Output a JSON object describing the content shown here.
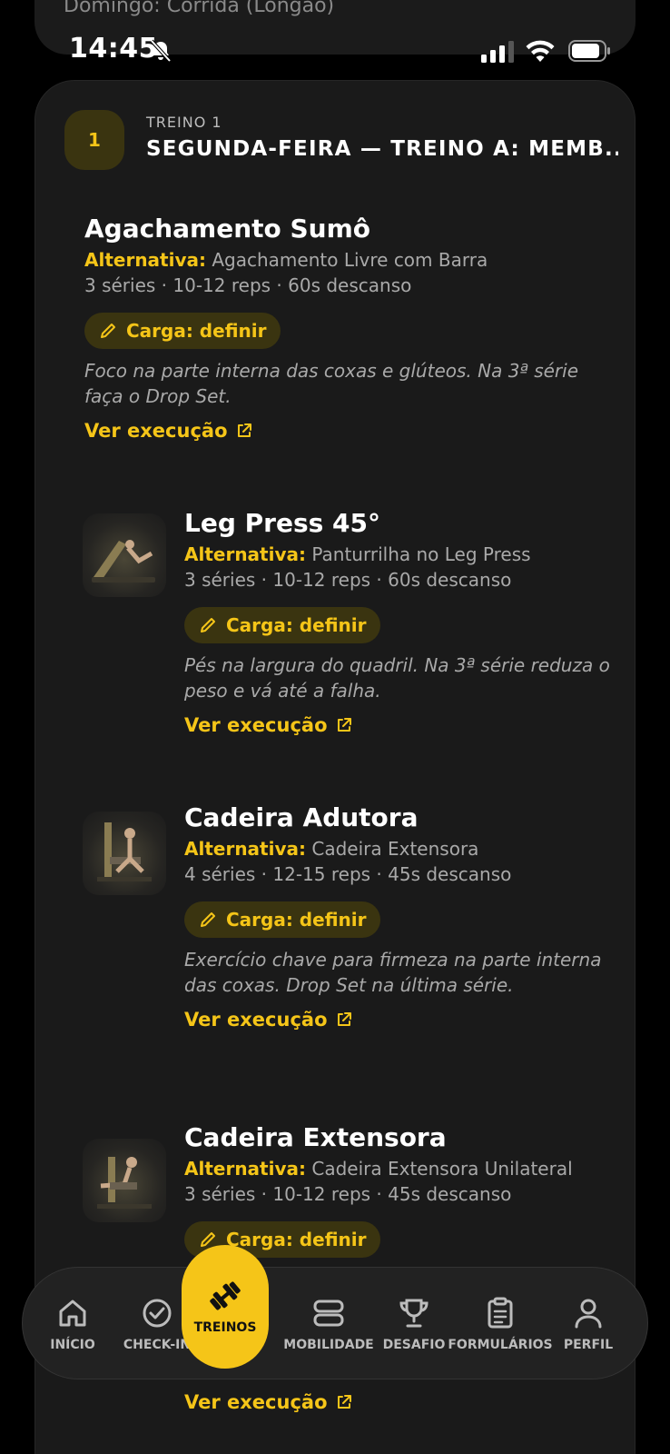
{
  "prev_card": {
    "text": "Domingo: Corrida (Longão)"
  },
  "status": {
    "time": "14:45"
  },
  "workout": {
    "number": "1",
    "subtitle": "TREINO 1",
    "title": "SEGUNDA-FEIRA — TREINO A: MEMB..."
  },
  "exercises": [
    {
      "name": "Agachamento Sumô",
      "alt_label": "Alternativa:",
      "alt_value": "Agachamento Livre com Barra",
      "meta": "3 séries · 10-12 reps · 60s descanso",
      "load": "Carga: definir",
      "note": "Foco na parte interna das coxas e glúteos. Na 3ª série faça o Drop Set.",
      "exec": "Ver execução"
    },
    {
      "name": "Leg Press 45°",
      "alt_label": "Alternativa:",
      "alt_value": "Panturrilha no Leg Press",
      "meta": "3 séries · 10-12 reps · 60s descanso",
      "load": "Carga: definir",
      "note": "Pés na largura do quadril. Na 3ª série reduza o peso e vá até a falha.",
      "exec": "Ver execução"
    },
    {
      "name": "Cadeira Adutora",
      "alt_label": "Alternativa:",
      "alt_value": "Cadeira Extensora",
      "meta": "4 séries · 12-15 reps · 45s descanso",
      "load": "Carga: definir",
      "note": "Exercício chave para firmeza na parte interna das coxas. Drop Set na última série.",
      "exec": "Ver execução"
    },
    {
      "name": "Cadeira Extensora",
      "alt_label": "Alternativa:",
      "alt_value": "Cadeira Extensora Unilateral",
      "meta": "3 séries · 10-12 reps · 45s descanso",
      "load": "Carga: definir",
      "exec": "Ver execução"
    }
  ],
  "nav": {
    "items": [
      "INÍCIO",
      "CHECK-IN",
      "TREINOS",
      "MOBILIDADE",
      "DESAFIO",
      "FORMULÁRIOS",
      "PERFIL"
    ],
    "active": "TREINOS"
  },
  "colors": {
    "accent": "#f5c518",
    "card": "#1a1a1a",
    "badge_bg": "#3a3410"
  }
}
